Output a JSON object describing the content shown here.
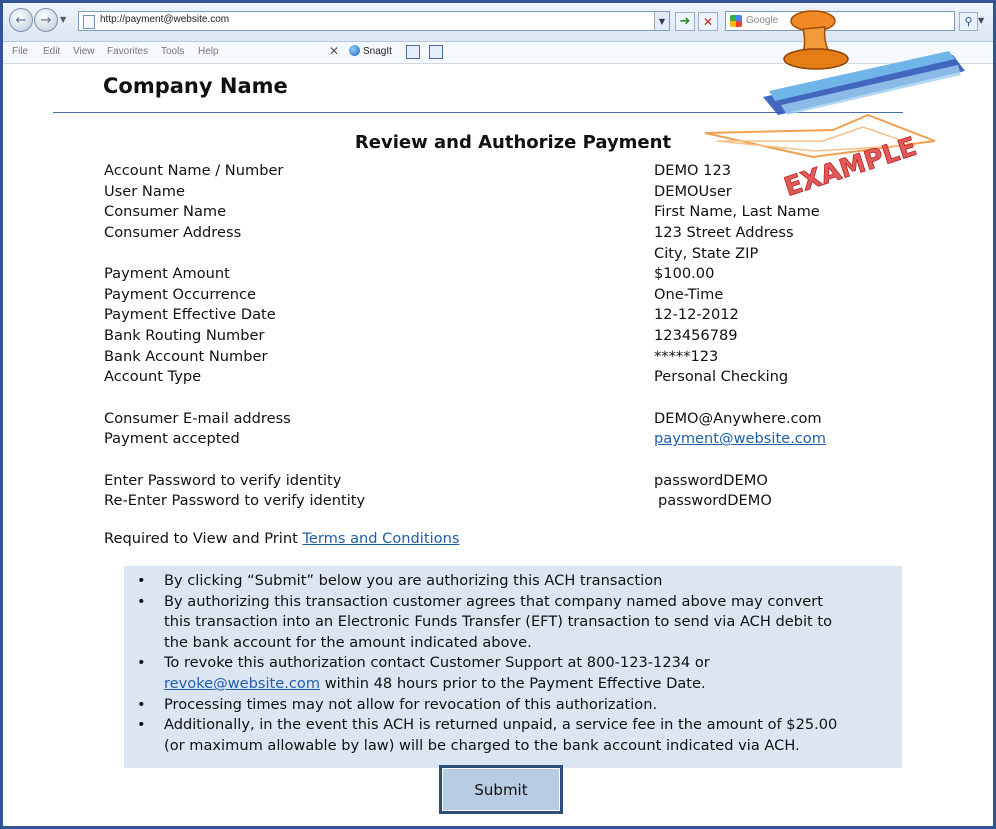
{
  "browser": {
    "address": "http://payment@website.com",
    "search_placeholder": "Google",
    "menu": [
      "File",
      "Edit",
      "View",
      "Favorites",
      "Tools",
      "Help"
    ],
    "snagit_label": "SnagIt"
  },
  "page": {
    "company_name": "Company Name",
    "title": "Review and Authorize Payment",
    "stamp_text": "EXAMPLE",
    "fields": [
      {
        "label": "Account Name / Number",
        "value": "DEMO 123"
      },
      {
        "label": "User Name",
        "value": "DEMOUser"
      },
      {
        "label": "Consumer Name",
        "value": "First Name, Last Name"
      },
      {
        "label": "Consumer Address",
        "value": "123 Street Address"
      },
      {
        "label": "",
        "value": "City, State ZIP"
      },
      {
        "label": "Payment Amount",
        "value": "$100.00"
      },
      {
        "label": "Payment Occurrence",
        "value": "One-Time"
      },
      {
        "label": "Payment Effective Date",
        "value": "12-12-2012"
      },
      {
        "label": "Bank Routing Number",
        "value": "123456789"
      },
      {
        "label": "Bank Account Number",
        "value": "*****123"
      },
      {
        "label": "Account Type",
        "value": "Personal Checking"
      },
      {
        "label": "",
        "value": ""
      },
      {
        "label": "Consumer E-mail address",
        "value": "DEMO@Anywhere.com"
      },
      {
        "label": "Payment accepted",
        "value": "payment@website.com"
      },
      {
        "label": "",
        "value": ""
      },
      {
        "label": "Enter Password to verify identity",
        "value": "passwordDEMO"
      },
      {
        "label": "Re-Enter Password to verify identity",
        "value": "passwordDEMO"
      }
    ],
    "terms_prefix": "Required to View and Print ",
    "terms_link": "Terms and Conditions",
    "notice": {
      "bullet": "•",
      "item1": "By clicking “Submit” below you are authorizing this ACH transaction",
      "item2": "By authorizing this transaction customer agrees that company named above may convert this transaction into an Electronic Funds Transfer (EFT) transaction to send via ACH debit to the bank account for the amount indicated above.",
      "item3_prefix": "To revoke this authorization contact Customer Support at 800-123-1234 or ",
      "item3_link": "revoke@website.com",
      "item3_suffix": " within 48 hours prior to the Payment Effective Date.",
      "item4": "Processing times may not allow for revocation of this authorization.",
      "item5": "Additionally, in the event this ACH is returned unpaid, a service fee in the amount of $25.00 (or maximum allowable by law) will be charged to the bank account indicated via ACH."
    },
    "submit_label": "Submit"
  }
}
